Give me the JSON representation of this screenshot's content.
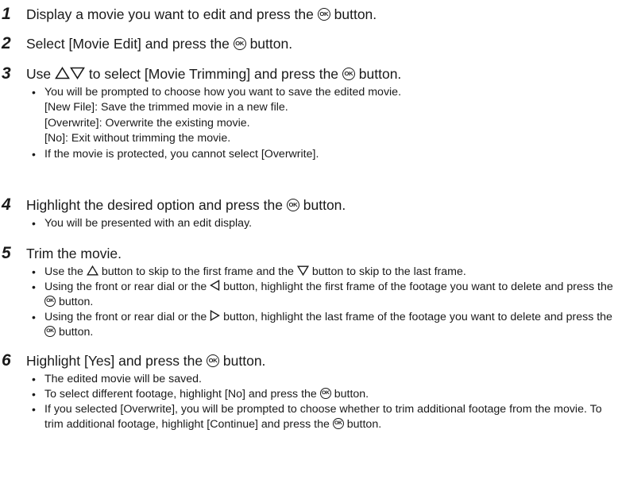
{
  "steps": [
    {
      "num": "1",
      "pre": "Display a movie you want to edit and press the",
      "post": "button."
    },
    {
      "num": "2",
      "pre": "Select [Movie Edit] and press the",
      "post": "button."
    },
    {
      "num": "3",
      "pre": "Use",
      "mid": "to select [Movie Trimming] and press the",
      "post": "button."
    },
    {
      "num": "4",
      "pre": "Highlight the desired option and press the",
      "post": "button."
    },
    {
      "num": "5",
      "text": "Trim the movie."
    },
    {
      "num": "6",
      "pre": "Highlight [Yes] and press the",
      "post": "button."
    }
  ],
  "step3_bullets": {
    "b1": "You will be prompted to choose how you want to save the edited movie.",
    "opt1": "[New File]: Save the trimmed movie in a new file.",
    "opt2": "[Overwrite]: Overwrite the existing movie.",
    "opt3": "[No]: Exit without trimming the movie.",
    "b2": "If the movie is protected, you cannot select [Overwrite]."
  },
  "step4_bullets": {
    "b1": "You will be presented with an edit display."
  },
  "step5_bullets": {
    "b1_pre": "Use the",
    "b1_mid": "button to skip to the first frame and the",
    "b1_post": "button to skip to the last frame.",
    "b2_pre": "Using the front or rear dial or the",
    "b2_mid": "button, highlight the first frame of the footage you want to delete and press the",
    "b2_post": "button.",
    "b3_pre": "Using the front or rear dial or the",
    "b3_mid": "button, highlight the last frame of the footage you want to delete and press the",
    "b3_post": "button."
  },
  "step6_bullets": {
    "b1": "The edited movie will be saved.",
    "b2_pre": "To select different footage, highlight [No] and press the",
    "b2_post": "button.",
    "b3_pre": "If you selected [Overwrite], you will be prompted to choose whether to trim additional footage from the movie. To trim additional footage, highlight [Continue] and press the",
    "b3_post": "button."
  },
  "icons": {
    "ok_label": "OK"
  }
}
